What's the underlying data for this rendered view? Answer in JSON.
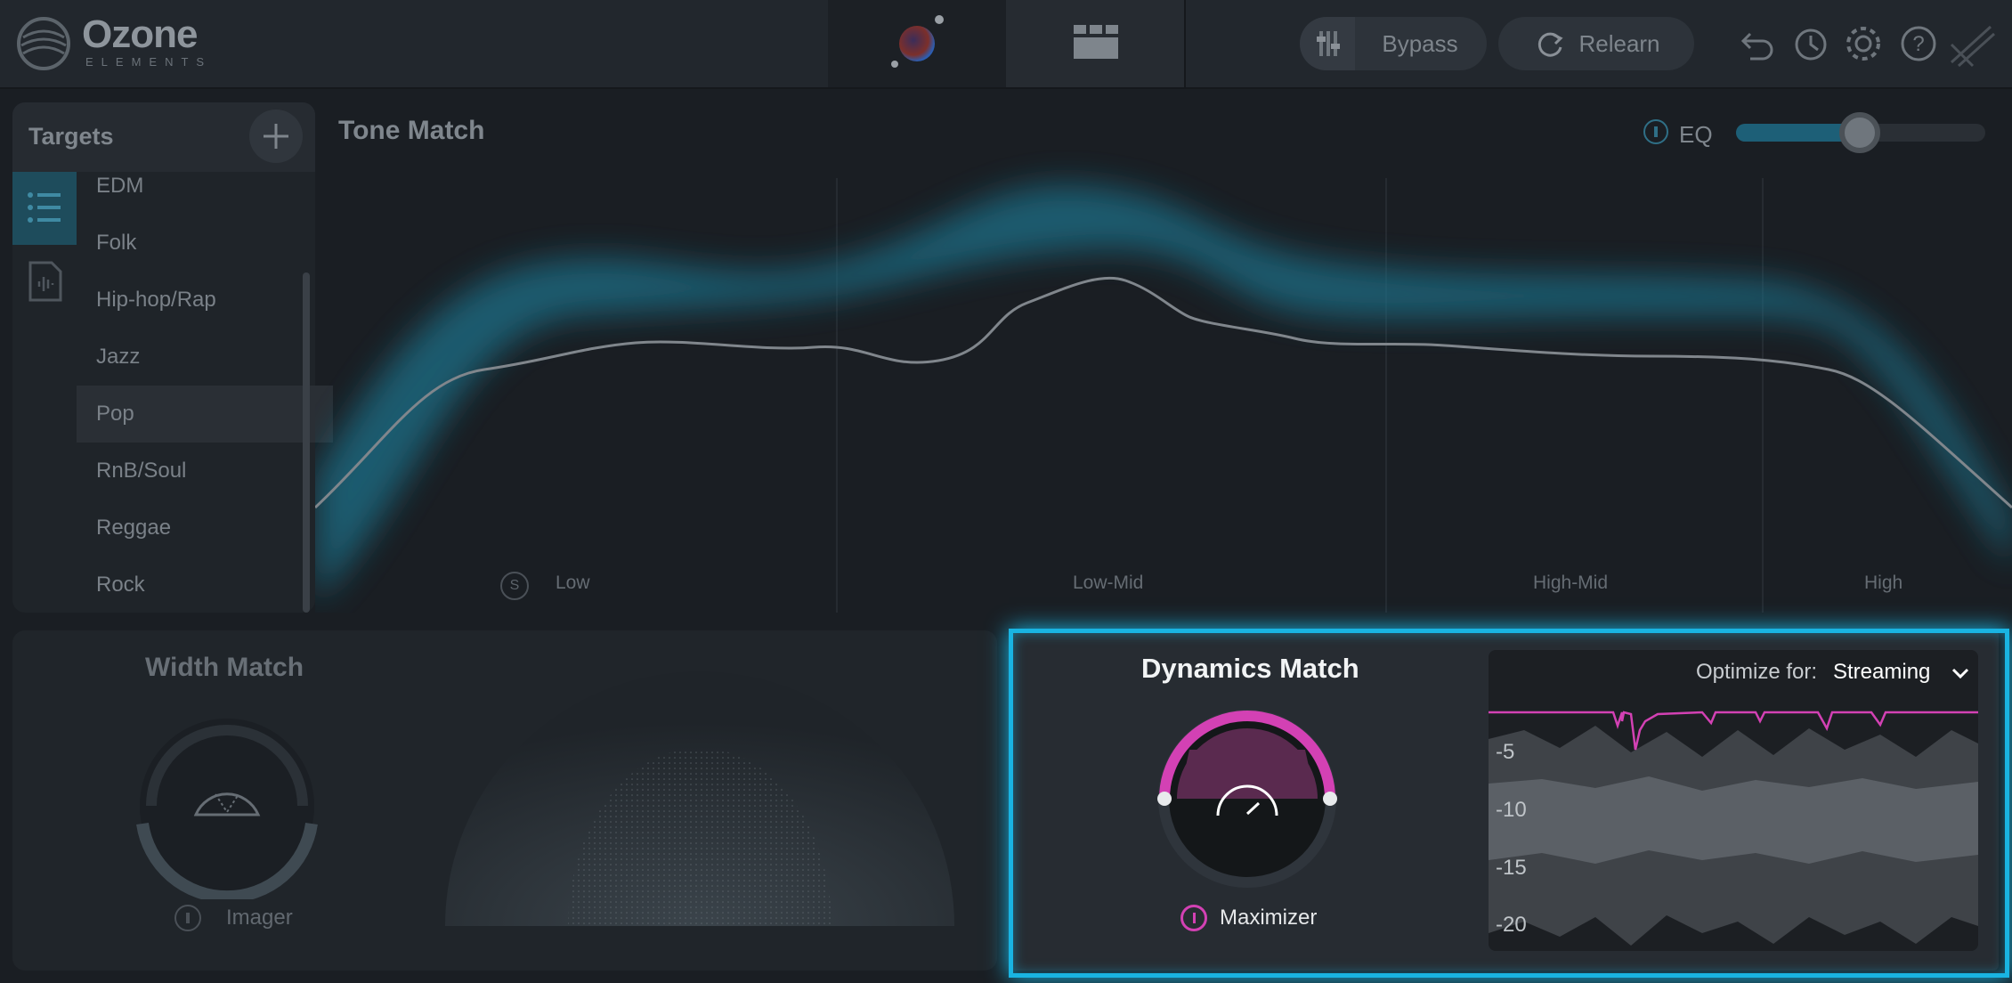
{
  "app": {
    "logo_name": "Ozone",
    "logo_sub": "ELEMENTS"
  },
  "toolbar": {
    "bypass_label": "Bypass",
    "relearn_label": "Relearn"
  },
  "targets": {
    "title": "Targets",
    "items": [
      {
        "label": "EDM"
      },
      {
        "label": "Folk"
      },
      {
        "label": "Hip-hop/Rap"
      },
      {
        "label": "Jazz"
      },
      {
        "label": "Pop",
        "selected": true
      },
      {
        "label": "RnB/Soul"
      },
      {
        "label": "Reggae"
      },
      {
        "label": "Rock"
      }
    ]
  },
  "tone_match": {
    "title": "Tone Match",
    "eq_label": "EQ",
    "eq_amount": 0.5,
    "bands": [
      "Low",
      "Low-Mid",
      "High-Mid",
      "High"
    ],
    "solo_label": "S"
  },
  "width_match": {
    "title": "Width Match",
    "imager_label": "Imager"
  },
  "dynamics_match": {
    "title": "Dynamics Match",
    "maximizer_label": "Maximizer",
    "optimize_label": "Optimize for:",
    "optimize_value": "Streaming",
    "y_ticks": [
      "-5",
      "-10",
      "-15",
      "-20"
    ]
  },
  "colors": {
    "accent": "#19b4e2",
    "maximizer": "#d341b4",
    "eq_fill": "#1d5f77"
  }
}
